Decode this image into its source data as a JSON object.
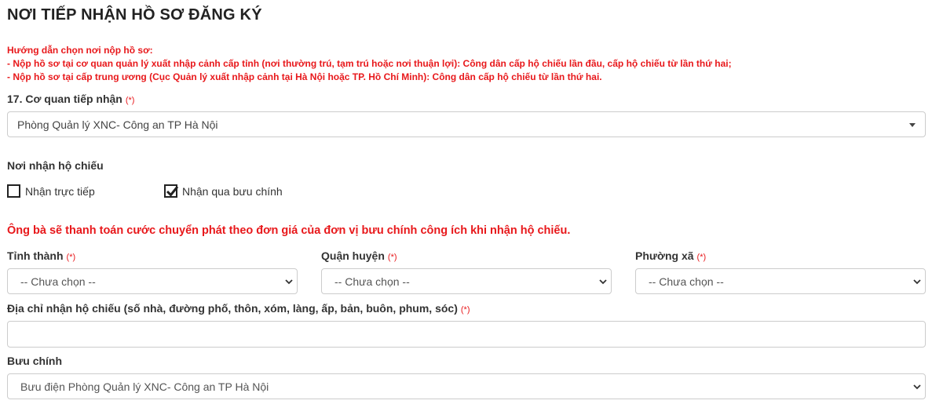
{
  "section": {
    "title": "NƠI TIẾP NHẬN HỒ SƠ ĐĂNG KÝ"
  },
  "guide": {
    "heading": "Hướng dẫn chọn nơi nộp hồ sơ:",
    "line1": "- Nộp hồ sơ tại cơ quan quản lý xuất nhập cảnh cấp tỉnh (nơi thường trú, tạm trú hoặc nơi thuận lợi): Công dân cấp hộ chiếu lần đầu, cấp hộ chiếu từ lần thứ hai;",
    "line2": "- Nộp hồ sơ tại cấp trung ương (Cục Quản lý xuất nhập cảnh tại Hà Nội hoặc TP. Hồ Chí Minh): Công dân cấp hộ chiếu từ lần thứ hai."
  },
  "required_marker": "(*)",
  "agency": {
    "label": "17. Cơ quan tiếp nhận",
    "selected": "Phòng Quản lý XNC- Công an TP Hà Nội"
  },
  "receive": {
    "label": "Nơi nhận hộ chiếu",
    "direct": {
      "label": "Nhận trực tiếp",
      "checked": false
    },
    "postal": {
      "label": "Nhận qua bưu chính",
      "checked": true
    }
  },
  "notice": "Ông bà sẽ thanh toán cước chuyển phát theo đơn giá của đơn vị bưu chính công ích khi nhận hộ chiếu.",
  "province": {
    "label": "Tỉnh thành",
    "selected": "-- Chưa chọn --"
  },
  "district": {
    "label": "Quận huyện",
    "selected": "-- Chưa chọn --"
  },
  "ward": {
    "label": "Phường xã",
    "selected": "-- Chưa chọn --"
  },
  "address": {
    "label": "Địa chỉ nhận hộ chiếu (số nhà, đường phố, thôn, xóm, làng, ấp, bản, buôn, phum, sóc)",
    "value": ""
  },
  "post_office": {
    "label": "Bưu chính",
    "selected": "Bưu điện Phòng Quản lý XNC- Công an TP Hà Nội"
  },
  "colors": {
    "required": "#e8181b",
    "text": "#333333",
    "border": "#cccccc"
  }
}
